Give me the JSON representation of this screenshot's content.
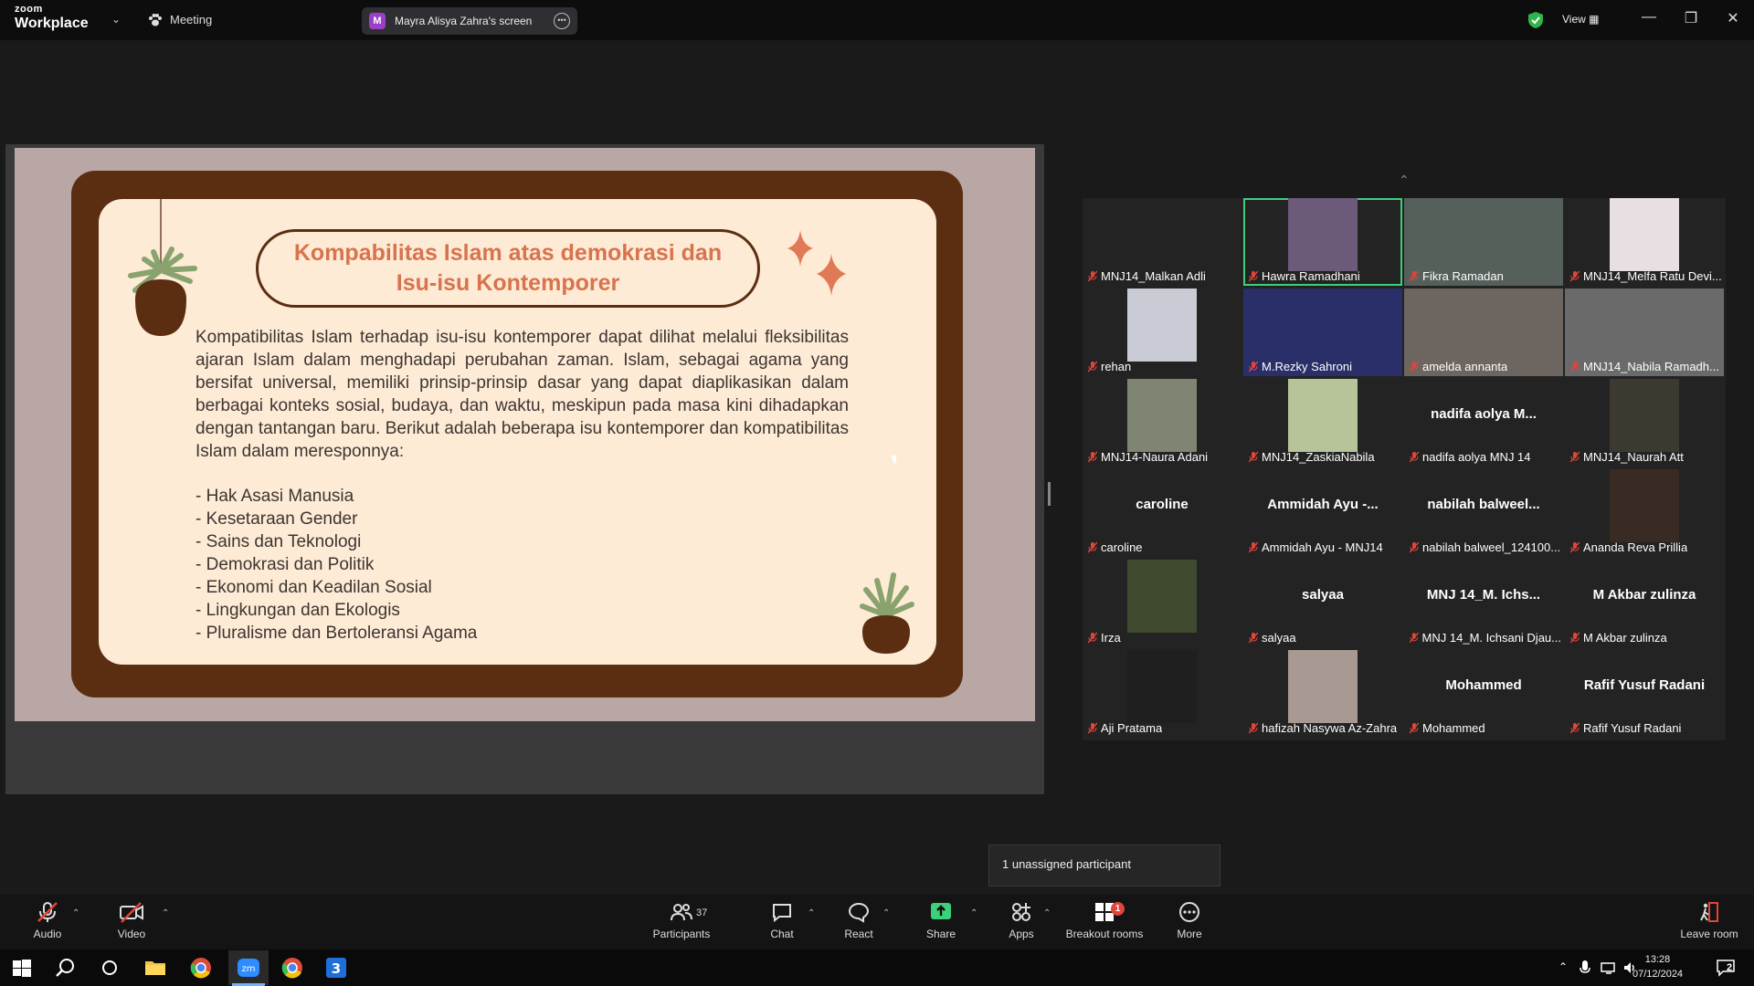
{
  "titlebar": {
    "brand_top": "zoom",
    "brand_bottom": "Workplace",
    "meeting_label": "Meeting",
    "screen_avatar": "M",
    "screen_label": "Mayra Alisya Zahra's screen",
    "view_label": "View"
  },
  "slide": {
    "title": "Kompabilitas Islam atas demokrasi dan Isu-isu Kontemporer",
    "body": "Kompatibilitas Islam terhadap isu-isu kontemporer dapat dilihat melalui fleksibilitas ajaran Islam dalam menghadapi perubahan zaman. Islam, sebagai agama yang bersifat universal, memiliki prinsip-prinsip dasar yang dapat diaplikasikan dalam berbagai konteks sosial, budaya, dan waktu, meskipun pada masa kini dihadapkan dengan tantangan baru. Berikut adalah beberapa isu kontemporer dan kompatibilitas Islam dalam meresponnya:",
    "list": [
      "- Hak Asasi Manusia",
      "- Kesetaraan Gender",
      "- Sains dan Teknologi",
      "- Demokrasi dan Politik",
      "- Ekonomi dan Keadilan Sosial",
      "- Lingkungan dan Ekologis",
      "- Pluralisme dan Bertoleransi Agama"
    ]
  },
  "gallery": {
    "participants": [
      {
        "name": "MNJ14_Malkan Adli",
        "big": ""
      },
      {
        "name": "Hawra Ramadhani",
        "big": ""
      },
      {
        "name": "Fikra Ramadan",
        "big": ""
      },
      {
        "name": "MNJ14_Melfa Ratu Devi...",
        "big": ""
      },
      {
        "name": "rehan",
        "big": ""
      },
      {
        "name": "M.Rezky Sahroni",
        "big": ""
      },
      {
        "name": "amelda annanta",
        "big": ""
      },
      {
        "name": "MNJ14_Nabila Ramadh...",
        "big": ""
      },
      {
        "name": "MNJ14-Naura Adani",
        "big": ""
      },
      {
        "name": "MNJ14_ZaskiaNabila",
        "big": ""
      },
      {
        "name": "nadifa aolya MNJ 14",
        "big": "nadifa aolya M..."
      },
      {
        "name": "MNJ14_Naurah Att",
        "big": ""
      },
      {
        "name": "caroline",
        "big": "caroline"
      },
      {
        "name": "Ammidah Ayu - MNJ14",
        "big": "Ammidah Ayu -..."
      },
      {
        "name": "nabilah balweel_124100...",
        "big": "nabilah  balweel..."
      },
      {
        "name": "Ananda Reva Prillia",
        "big": ""
      },
      {
        "name": "Irza",
        "big": ""
      },
      {
        "name": "salyaa",
        "big": "salyaa"
      },
      {
        "name": "MNJ 14_M. Ichsani Djau...",
        "big": "MNJ 14_M. Ichs..."
      },
      {
        "name": "M Akbar zulinza",
        "big": "M Akbar zulinza"
      },
      {
        "name": "Aji Pratama",
        "big": ""
      },
      {
        "name": "hafizah Nasywa Az-Zahra",
        "big": ""
      },
      {
        "name": "Mohammed",
        "big": "Mohammed"
      },
      {
        "name": "Rafif Yusuf Radani",
        "big": "Rafif Yusuf Radani"
      }
    ]
  },
  "tooltip": "1 unassigned participant",
  "toolbar": {
    "audio": "Audio",
    "video": "Video",
    "participants": "Participants",
    "participants_count": "37",
    "chat": "Chat",
    "react": "React",
    "share": "Share",
    "apps": "Apps",
    "breakout": "Breakout rooms",
    "breakout_badge": "1",
    "more": "More",
    "leave": "Leave room"
  },
  "taskbar": {
    "time": "13:28",
    "date": "07/12/2024",
    "notif_count": "2"
  },
  "colors": {
    "accent_green": "#3bd17a",
    "slide_title": "#d8734d",
    "slide_frame": "#5b2e12",
    "muted_red": "#e0453b"
  }
}
